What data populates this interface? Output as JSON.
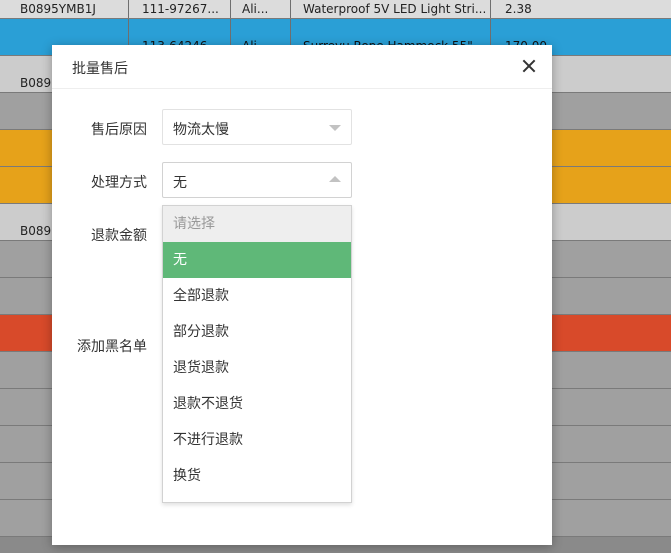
{
  "background_rows": [
    {
      "sku": "B0895YMB1J",
      "order": "111-97267...",
      "store": "Ali...",
      "title": "Waterproof 5V LED Light Stri...",
      "price": "2.38",
      "color": "#dcdcdc"
    },
    {
      "sku": "",
      "order": "113-64246...",
      "store": "Ali",
      "title": "Surreyu Rope Hammock 55\"...",
      "price": "170.00",
      "color": "#2a9fd6"
    },
    {
      "sku": "B0895",
      "order": "",
      "store": "",
      "title": "",
      "price": "",
      "color": "#cccccc"
    },
    {
      "sku": "",
      "order": "",
      "store": "",
      "title": "",
      "price": "",
      "color": "#a0a0a0"
    },
    {
      "sku": "",
      "order": "",
      "store": "",
      "title": "",
      "price": "",
      "color": "#e6a21a"
    },
    {
      "sku": "",
      "order": "",
      "store": "",
      "title": "",
      "price": "",
      "color": "#e6a21a"
    },
    {
      "sku": "B0895",
      "order": "",
      "store": "",
      "title": "",
      "price": "",
      "color": "#cccccc"
    },
    {
      "sku": "",
      "order": "",
      "store": "",
      "title": "",
      "price": "",
      "color": "#a0a0a0"
    },
    {
      "sku": "",
      "order": "",
      "store": "",
      "title": "",
      "price": "",
      "color": "#a0a0a0"
    },
    {
      "sku": "",
      "order": "",
      "store": "",
      "title": "",
      "price": "",
      "color": "#d84a2a"
    },
    {
      "sku": "",
      "order": "",
      "store": "",
      "title": "",
      "price": "",
      "color": "#a0a0a0"
    },
    {
      "sku": "",
      "order": "",
      "store": "",
      "title": "",
      "price": "",
      "color": "#a0a0a0"
    },
    {
      "sku": "",
      "order": "",
      "store": "",
      "title": "",
      "price": "",
      "color": "#a0a0a0"
    },
    {
      "sku": "",
      "order": "",
      "store": "",
      "title": "",
      "price": "",
      "color": "#a0a0a0"
    },
    {
      "sku": "",
      "order": "",
      "store": "",
      "title": "",
      "price": "",
      "color": "#a0a0a0"
    }
  ],
  "dialog": {
    "title": "批量售后",
    "close_icon": "close-icon",
    "fields": {
      "reason_label": "售后原因",
      "reason_value": "物流太慢",
      "method_label": "处理方式",
      "method_value": "无",
      "refund_label": "退款金额",
      "blacklist_label": "添加黑名单"
    },
    "dropdown_options": [
      {
        "label": "请选择",
        "state": "placeholder"
      },
      {
        "label": "无",
        "state": "selected"
      },
      {
        "label": "全部退款",
        "state": "normal"
      },
      {
        "label": "部分退款",
        "state": "normal"
      },
      {
        "label": "退货退款",
        "state": "normal"
      },
      {
        "label": "退款不退货",
        "state": "normal"
      },
      {
        "label": "不进行退款",
        "state": "normal"
      },
      {
        "label": "换货",
        "state": "normal"
      }
    ]
  },
  "colors": {
    "selected_option": "#5FB878",
    "placeholder_bg": "#eeeeee"
  }
}
